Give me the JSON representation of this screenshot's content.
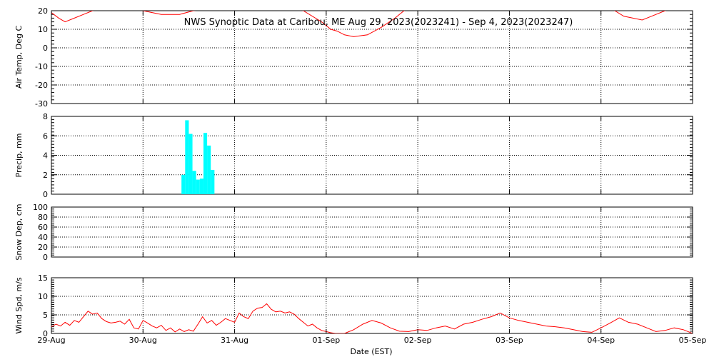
{
  "title": "NWS Synoptic Data at Caribou, ME   Aug 29, 2023(2023241) - Sep  4, 2023(2023247)",
  "xlabel": "Date (EST)",
  "x_ticks": [
    "29-Aug",
    "30-Aug",
    "31-Aug",
    "01-Sep",
    "02-Sep",
    "03-Sep",
    "04-Sep",
    "05-Sep"
  ],
  "colors": {
    "series": "#ff0000",
    "precip": "#00ffff",
    "axis": "#000000"
  },
  "chart_data": [
    {
      "type": "line",
      "ylabel": "Air Temp, Deg C",
      "ylim": [
        -30,
        20
      ],
      "y_ticks": [
        "20",
        "10",
        "0",
        "-10",
        "-20",
        "-30"
      ],
      "x_unit": "days since 29-Aug 00:00 EST",
      "series": [
        {
          "x": [
            0,
            0.08,
            0.15,
            0.25,
            0.35,
            0.45,
            0.55,
            0.65,
            0.75,
            0.85,
            1.0,
            1.2,
            1.4,
            1.55,
            1.7,
            1.85,
            2.0,
            2.2,
            2.4,
            2.6,
            2.75,
            2.85,
            2.95,
            3.05,
            3.12,
            3.2,
            3.3,
            3.45,
            3.6,
            3.75,
            3.85,
            3.95,
            4.1,
            4.3,
            4.5,
            4.7,
            4.9,
            5.1,
            5.3,
            5.5,
            5.65,
            5.8,
            5.95,
            6.05,
            6.15,
            6.25,
            6.35,
            6.45,
            6.55,
            6.7,
            6.85,
            7.0
          ],
          "y": [
            19,
            16,
            14,
            16,
            18,
            20,
            22,
            23,
            23,
            22,
            20,
            18,
            18,
            20,
            21,
            22,
            22,
            22,
            22,
            22,
            20,
            17,
            14,
            10,
            9,
            7,
            6,
            7,
            11,
            16,
            20,
            22,
            23,
            23,
            23,
            22,
            22,
            22,
            22,
            22,
            23,
            23,
            23,
            23,
            20,
            17,
            16,
            15,
            17,
            20,
            22,
            23
          ]
        }
      ]
    },
    {
      "type": "bar",
      "ylabel": "Precip, mm",
      "ylim": [
        0,
        8
      ],
      "y_ticks": [
        "8",
        "6",
        "4",
        "2",
        "0"
      ],
      "x_unit": "days since 29-Aug 00:00 EST",
      "bar_width": 0.04,
      "series": [
        {
          "x": [
            1.42,
            1.46,
            1.5,
            1.54,
            1.58,
            1.62,
            1.66,
            1.7,
            1.74,
            1.78
          ],
          "values": [
            2.0,
            7.6,
            6.2,
            2.4,
            1.5,
            1.6,
            6.3,
            5.0,
            2.5,
            0
          ]
        }
      ]
    },
    {
      "type": "line",
      "ylabel": "Snow Dep, cm",
      "ylim": [
        0,
        100
      ],
      "y_ticks": [
        "100",
        "80",
        "60",
        "40",
        "20",
        "0"
      ],
      "x_unit": "days since 29-Aug 00:00 EST",
      "series": []
    },
    {
      "type": "line",
      "ylabel": "Wind Spd, m/s",
      "ylim": [
        0,
        15
      ],
      "y_ticks": [
        "15",
        "10",
        "5",
        "0"
      ],
      "x_unit": "days since 29-Aug 00:00 EST",
      "series": [
        {
          "x": [
            0,
            0.05,
            0.1,
            0.15,
            0.2,
            0.25,
            0.3,
            0.35,
            0.4,
            0.45,
            0.5,
            0.55,
            0.6,
            0.65,
            0.7,
            0.75,
            0.8,
            0.85,
            0.9,
            0.95,
            1.0,
            1.05,
            1.1,
            1.15,
            1.2,
            1.25,
            1.3,
            1.35,
            1.4,
            1.45,
            1.5,
            1.55,
            1.6,
            1.65,
            1.7,
            1.75,
            1.8,
            1.85,
            1.9,
            1.95,
            2.0,
            2.05,
            2.1,
            2.15,
            2.2,
            2.25,
            2.3,
            2.35,
            2.4,
            2.45,
            2.5,
            2.55,
            2.6,
            2.65,
            2.7,
            2.75,
            2.8,
            2.85,
            2.9,
            2.95,
            3.0,
            3.05,
            3.1,
            3.2,
            3.3,
            3.4,
            3.5,
            3.6,
            3.7,
            3.8,
            3.9,
            4.0,
            4.1,
            4.2,
            4.3,
            4.4,
            4.5,
            4.6,
            4.7,
            4.8,
            4.9,
            5.0,
            5.1,
            5.2,
            5.3,
            5.4,
            5.5,
            5.6,
            5.7,
            5.8,
            5.9,
            6.0,
            6.1,
            6.2,
            6.3,
            6.4,
            6.5,
            6.6,
            6.7,
            6.8,
            6.9,
            7.0
          ],
          "y": [
            1.8,
            2.5,
            2.0,
            3.0,
            2.2,
            3.5,
            3.0,
            4.5,
            6.0,
            5.2,
            5.5,
            4.0,
            3.2,
            2.8,
            3.0,
            3.3,
            2.5,
            3.8,
            1.5,
            1.2,
            3.5,
            2.8,
            2.0,
            1.5,
            2.2,
            0.8,
            1.5,
            0.4,
            1.2,
            0.5,
            1.0,
            0.6,
            2.5,
            4.5,
            2.8,
            3.5,
            2.2,
            3.0,
            4.0,
            3.5,
            3.0,
            5.5,
            4.5,
            4.0,
            6.0,
            6.8,
            7.0,
            8.0,
            6.5,
            5.8,
            6.0,
            5.5,
            5.8,
            5.2,
            4.0,
            3.0,
            2.0,
            2.5,
            1.5,
            0.8,
            0.5,
            0.2,
            0.0,
            0.0,
            1.0,
            2.5,
            3.5,
            2.8,
            1.5,
            0.6,
            0.5,
            1.0,
            0.8,
            1.5,
            2.0,
            1.2,
            2.5,
            3.0,
            3.8,
            4.5,
            5.5,
            4.2,
            3.5,
            3.0,
            2.5,
            2.0,
            1.8,
            1.5,
            1.0,
            0.5,
            0.3,
            1.5,
            2.8,
            4.2,
            3.0,
            2.5,
            1.5,
            0.5,
            0.8,
            1.5,
            1.0,
            0.0
          ]
        }
      ]
    }
  ]
}
